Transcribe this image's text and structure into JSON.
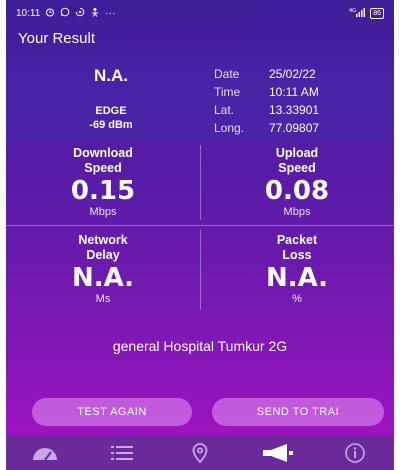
{
  "status_bar": {
    "time": "10:11",
    "notification_icons": [
      "alarm-icon",
      "whatsapp-icon",
      "data-saver-icon",
      "person-icon"
    ],
    "more": "···",
    "signal": "4G",
    "battery": "86"
  },
  "header": {
    "title": "Your Result"
  },
  "summary": {
    "network_type_value": "N.A.",
    "technology": "EDGE",
    "signal_strength": "-69 dBm",
    "info": [
      {
        "key": "Date",
        "value": "25/02/22"
      },
      {
        "key": "Time",
        "value": "10:11 AM"
      },
      {
        "key": "Lat.",
        "value": "13.33901"
      },
      {
        "key": "Long.",
        "value": "77.09807"
      }
    ]
  },
  "metrics": {
    "download": {
      "label_line1": "Download",
      "label_line2": "Speed",
      "value": "0.15",
      "unit": "Mbps"
    },
    "upload": {
      "label_line1": "Upload",
      "label_line2": "Speed",
      "value": "0.08",
      "unit": "Mbps"
    },
    "delay": {
      "label_line1": "Network",
      "label_line2": "Delay",
      "value": "N.A.",
      "unit": "Ms"
    },
    "loss": {
      "label_line1": "Packet",
      "label_line2": "Loss",
      "value": "N.A.",
      "unit": "%"
    }
  },
  "location": "general Hospital Tumkur 2G",
  "buttons": {
    "test_again": "TEST AGAIN",
    "send": "SEND TO TRAI"
  },
  "bottom_nav": [
    "speedometer-icon",
    "list-icon",
    "location-pin-icon",
    "megaphone-icon",
    "info-icon"
  ],
  "colors": {
    "gradient_top": "#3d1f9a",
    "gradient_bottom": "#a712c4",
    "nav_bg": "#6a2a9a",
    "button_bg": "#e696f5"
  }
}
